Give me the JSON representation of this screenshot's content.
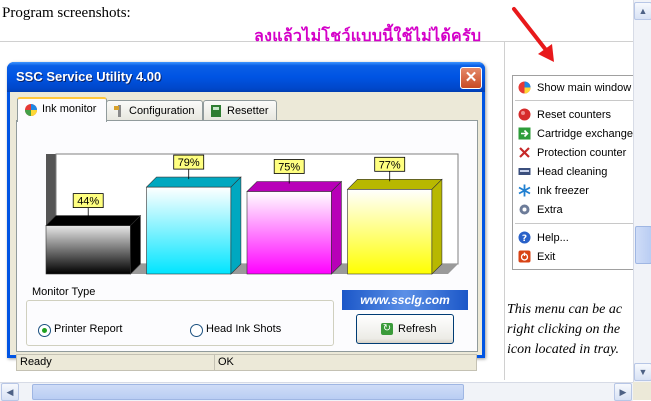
{
  "page": {
    "header": "Program screenshots:",
    "caption_thai": "ลงแล้วไม่โชว์แบบนี้ใช้ไม่ได้ครับ",
    "side_note": [
      "This menu can be ac",
      "right clicking on the",
      "icon located in tray."
    ]
  },
  "window": {
    "title": "SSC Service Utility 4.00",
    "close_label": "✕"
  },
  "tabs": [
    {
      "label": "Ink monitor",
      "icon": "ink-drop-icon",
      "active": true
    },
    {
      "label": "Configuration",
      "icon": "tools-icon",
      "active": false
    },
    {
      "label": "Resetter",
      "icon": "chip-icon",
      "active": false
    }
  ],
  "chart_data": {
    "type": "bar",
    "categories": [
      "Black",
      "Cyan",
      "Magenta",
      "Yellow"
    ],
    "values": [
      44,
      79,
      75,
      77
    ],
    "labels": [
      "44%",
      "79%",
      "75%",
      "77%"
    ],
    "ylim": [
      0,
      100
    ],
    "colors": [
      "#000000",
      "#00e5ff",
      "#ff00ff",
      "#ffff00"
    ]
  },
  "monitor": {
    "title": "Monitor Type",
    "options": [
      "Printer Report",
      "Head Ink Shots"
    ],
    "selected": "Printer Report",
    "website": "www.ssclg.com",
    "refresh_label": "Refresh"
  },
  "status": {
    "left": "Ready",
    "right": "OK"
  },
  "tray_menu": {
    "items": [
      {
        "label": "Show main window",
        "icon": "ink-drop-icon",
        "bold": true
      },
      {
        "separator": true
      },
      {
        "label": "Reset counters",
        "icon": "red-circle-icon"
      },
      {
        "label": "Cartridge exchange",
        "icon": "green-arrow-icon"
      },
      {
        "label": "Protection counter",
        "icon": "x-icon"
      },
      {
        "label": "Head cleaning",
        "icon": "printer-head-icon"
      },
      {
        "label": "Ink freezer",
        "icon": "snowflake-icon"
      },
      {
        "label": "Extra",
        "icon": "gear-icon"
      },
      {
        "separator": true
      },
      {
        "label": "Help...",
        "icon": "help-icon"
      },
      {
        "label": "Exit",
        "icon": "exit-icon"
      }
    ]
  },
  "colors": {
    "xp_blue": "#0054e3",
    "caption": "#d400c8",
    "arrow": "#e8191b"
  }
}
